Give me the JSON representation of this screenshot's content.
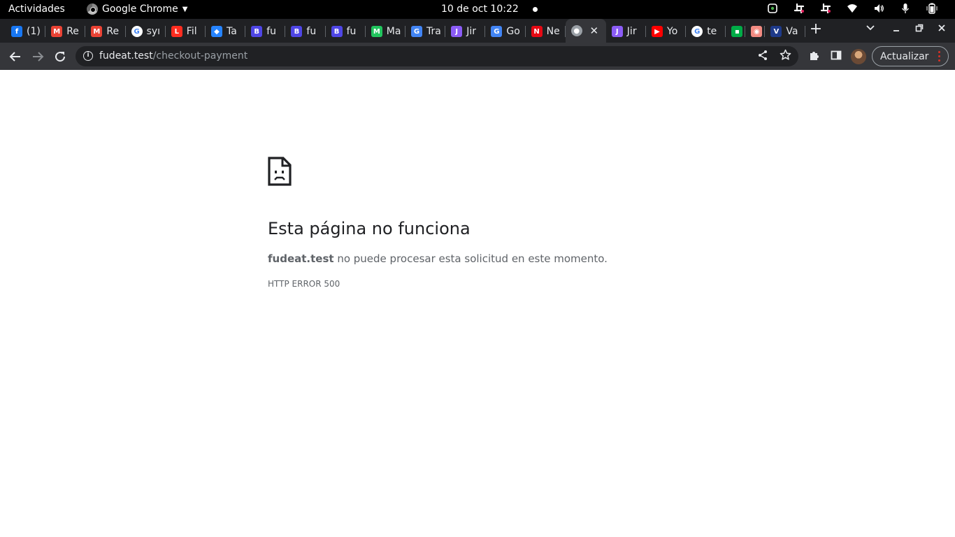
{
  "topbar": {
    "activities": "Actividades",
    "app_name": "Google Chrome",
    "clock": "10 de oct  10:22",
    "tray_icons": [
      "sync-icon",
      "slack-icon",
      "slack-icon",
      "wifi-icon",
      "volume-icon",
      "microphone-icon",
      "battery-icon"
    ]
  },
  "tabs": [
    {
      "label": "(1)",
      "favicon": "facebook-icon",
      "color": "#1877f2",
      "glyph": "f"
    },
    {
      "label": "Re",
      "favicon": "gmail-icon",
      "color": "#ea4335",
      "glyph": "M"
    },
    {
      "label": "Re",
      "favicon": "gmail-icon",
      "color": "#ea4335",
      "glyph": "M"
    },
    {
      "label": "syı",
      "favicon": "google-icon",
      "color": "#ffffff",
      "glyph": "G"
    },
    {
      "label": "Fil",
      "favicon": "laravel-icon",
      "color": "#ff2d20",
      "glyph": "L"
    },
    {
      "label": "Ta",
      "favicon": "jira-icon",
      "color": "#2684ff",
      "glyph": "◆"
    },
    {
      "label": "fu",
      "favicon": "bootstrap-icon",
      "color": "#4f46e5",
      "glyph": "B"
    },
    {
      "label": "fu",
      "favicon": "bootstrap-icon",
      "color": "#4f46e5",
      "glyph": "B"
    },
    {
      "label": "fu",
      "favicon": "bootstrap-icon",
      "color": "#4f46e5",
      "glyph": "B"
    },
    {
      "label": "Ma",
      "favicon": "mailtrap-icon",
      "color": "#22c55e",
      "glyph": "M"
    },
    {
      "label": "Tra",
      "favicon": "translate-icon",
      "color": "#4285f4",
      "glyph": "G"
    },
    {
      "label": "Jir",
      "favicon": "jira-icon",
      "color": "#8b5cf6",
      "glyph": "J"
    },
    {
      "label": "Go",
      "favicon": "translate-icon",
      "color": "#4285f4",
      "glyph": "G"
    },
    {
      "label": "Ne",
      "favicon": "netflix-icon",
      "color": "#e50914",
      "glyph": "N"
    },
    {
      "label": "",
      "favicon": "globe-icon",
      "color": "#9aa0a6",
      "glyph": "●",
      "active": true
    },
    {
      "label": "Jir",
      "favicon": "jira-icon",
      "color": "#8b5cf6",
      "glyph": "J"
    },
    {
      "label": "Yo",
      "favicon": "youtube-icon",
      "color": "#ff0000",
      "glyph": "▶"
    },
    {
      "label": "te",
      "favicon": "google-icon",
      "color": "#ffffff",
      "glyph": "G"
    },
    {
      "label": "",
      "favicon": "meet-icon",
      "color": "#00ac47",
      "glyph": "▪"
    },
    {
      "label": "",
      "favicon": "record-icon",
      "color": "#f28b82",
      "glyph": "◉"
    },
    {
      "label": "Va",
      "favicon": "vaultwarden-icon",
      "color": "#1e3a8a",
      "glyph": "V"
    }
  ],
  "toolbar": {
    "url_host": "fudeat.test",
    "url_path": "/checkout-payment",
    "update_label": "Actualizar"
  },
  "page": {
    "title": "Esta página no funciona",
    "host": "fudeat.test",
    "description": " no puede procesar esta solicitud en este momento.",
    "error_code": "HTTP ERROR 500"
  }
}
